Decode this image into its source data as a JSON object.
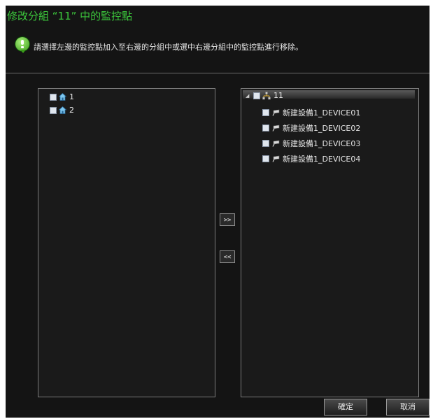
{
  "dialog": {
    "title": "修改分組 “11” 中的監控點",
    "hint": "請選擇左邊的監控點加入至右邊的分組中或選中右邊分組中的監控點進行移除。",
    "left_tree": [
      {
        "label": "1",
        "icon": "house-icon"
      },
      {
        "label": "2",
        "icon": "house-icon"
      }
    ],
    "right_tree": {
      "root": {
        "label": "11",
        "icon": "network-icon",
        "expanded": true
      },
      "children": [
        {
          "label": "新建設備1_DEVICE01",
          "icon": "camera-icon"
        },
        {
          "label": "新建設備1_DEVICE02",
          "icon": "camera-icon"
        },
        {
          "label": "新建設備1_DEVICE03",
          "icon": "camera-icon"
        },
        {
          "label": "新建設備1_DEVICE04",
          "icon": "camera-icon"
        }
      ]
    },
    "add_button": ">>",
    "remove_button": "<<",
    "ok_button": "確定",
    "cancel_button": "取消"
  },
  "colors": {
    "background": "#141414",
    "title": "#3cc83c",
    "text": "#e8e8e8",
    "border": "#7a7a7a"
  }
}
